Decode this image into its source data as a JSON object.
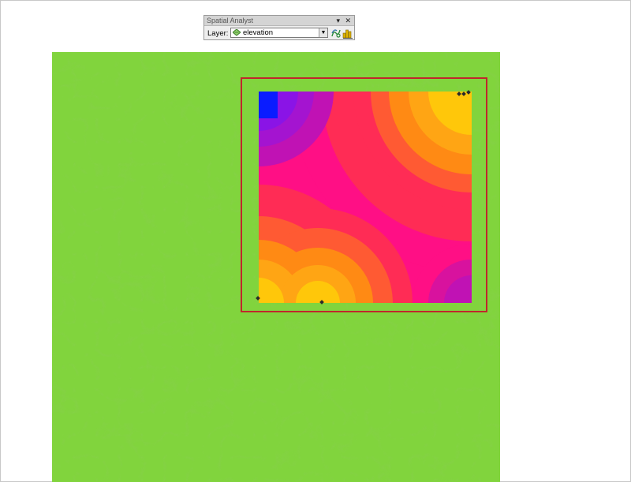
{
  "toolbar": {
    "title": "Spatial Analyst",
    "controls": "▾ ✕",
    "layer_label": "Layer:",
    "layer_value": "elevation",
    "layer_icon": "raster-layer-icon",
    "buttons": [
      "contour-icon",
      "histogram-icon"
    ]
  },
  "map": {
    "layer": "elevation",
    "colors": {
      "ramp_low": "#3aa90f",
      "ramp_mid": "#f6f900",
      "ramp_high": "#ff1800",
      "extent_outline": "#c0262c"
    }
  },
  "overlay": {
    "layer": "distance raster",
    "colors": [
      "#0a1cff",
      "#8a14e6",
      "#c012b4",
      "#ff0f85",
      "#ff2c55",
      "#ff5a33",
      "#ff8a14",
      "#ffc70a"
    ]
  }
}
